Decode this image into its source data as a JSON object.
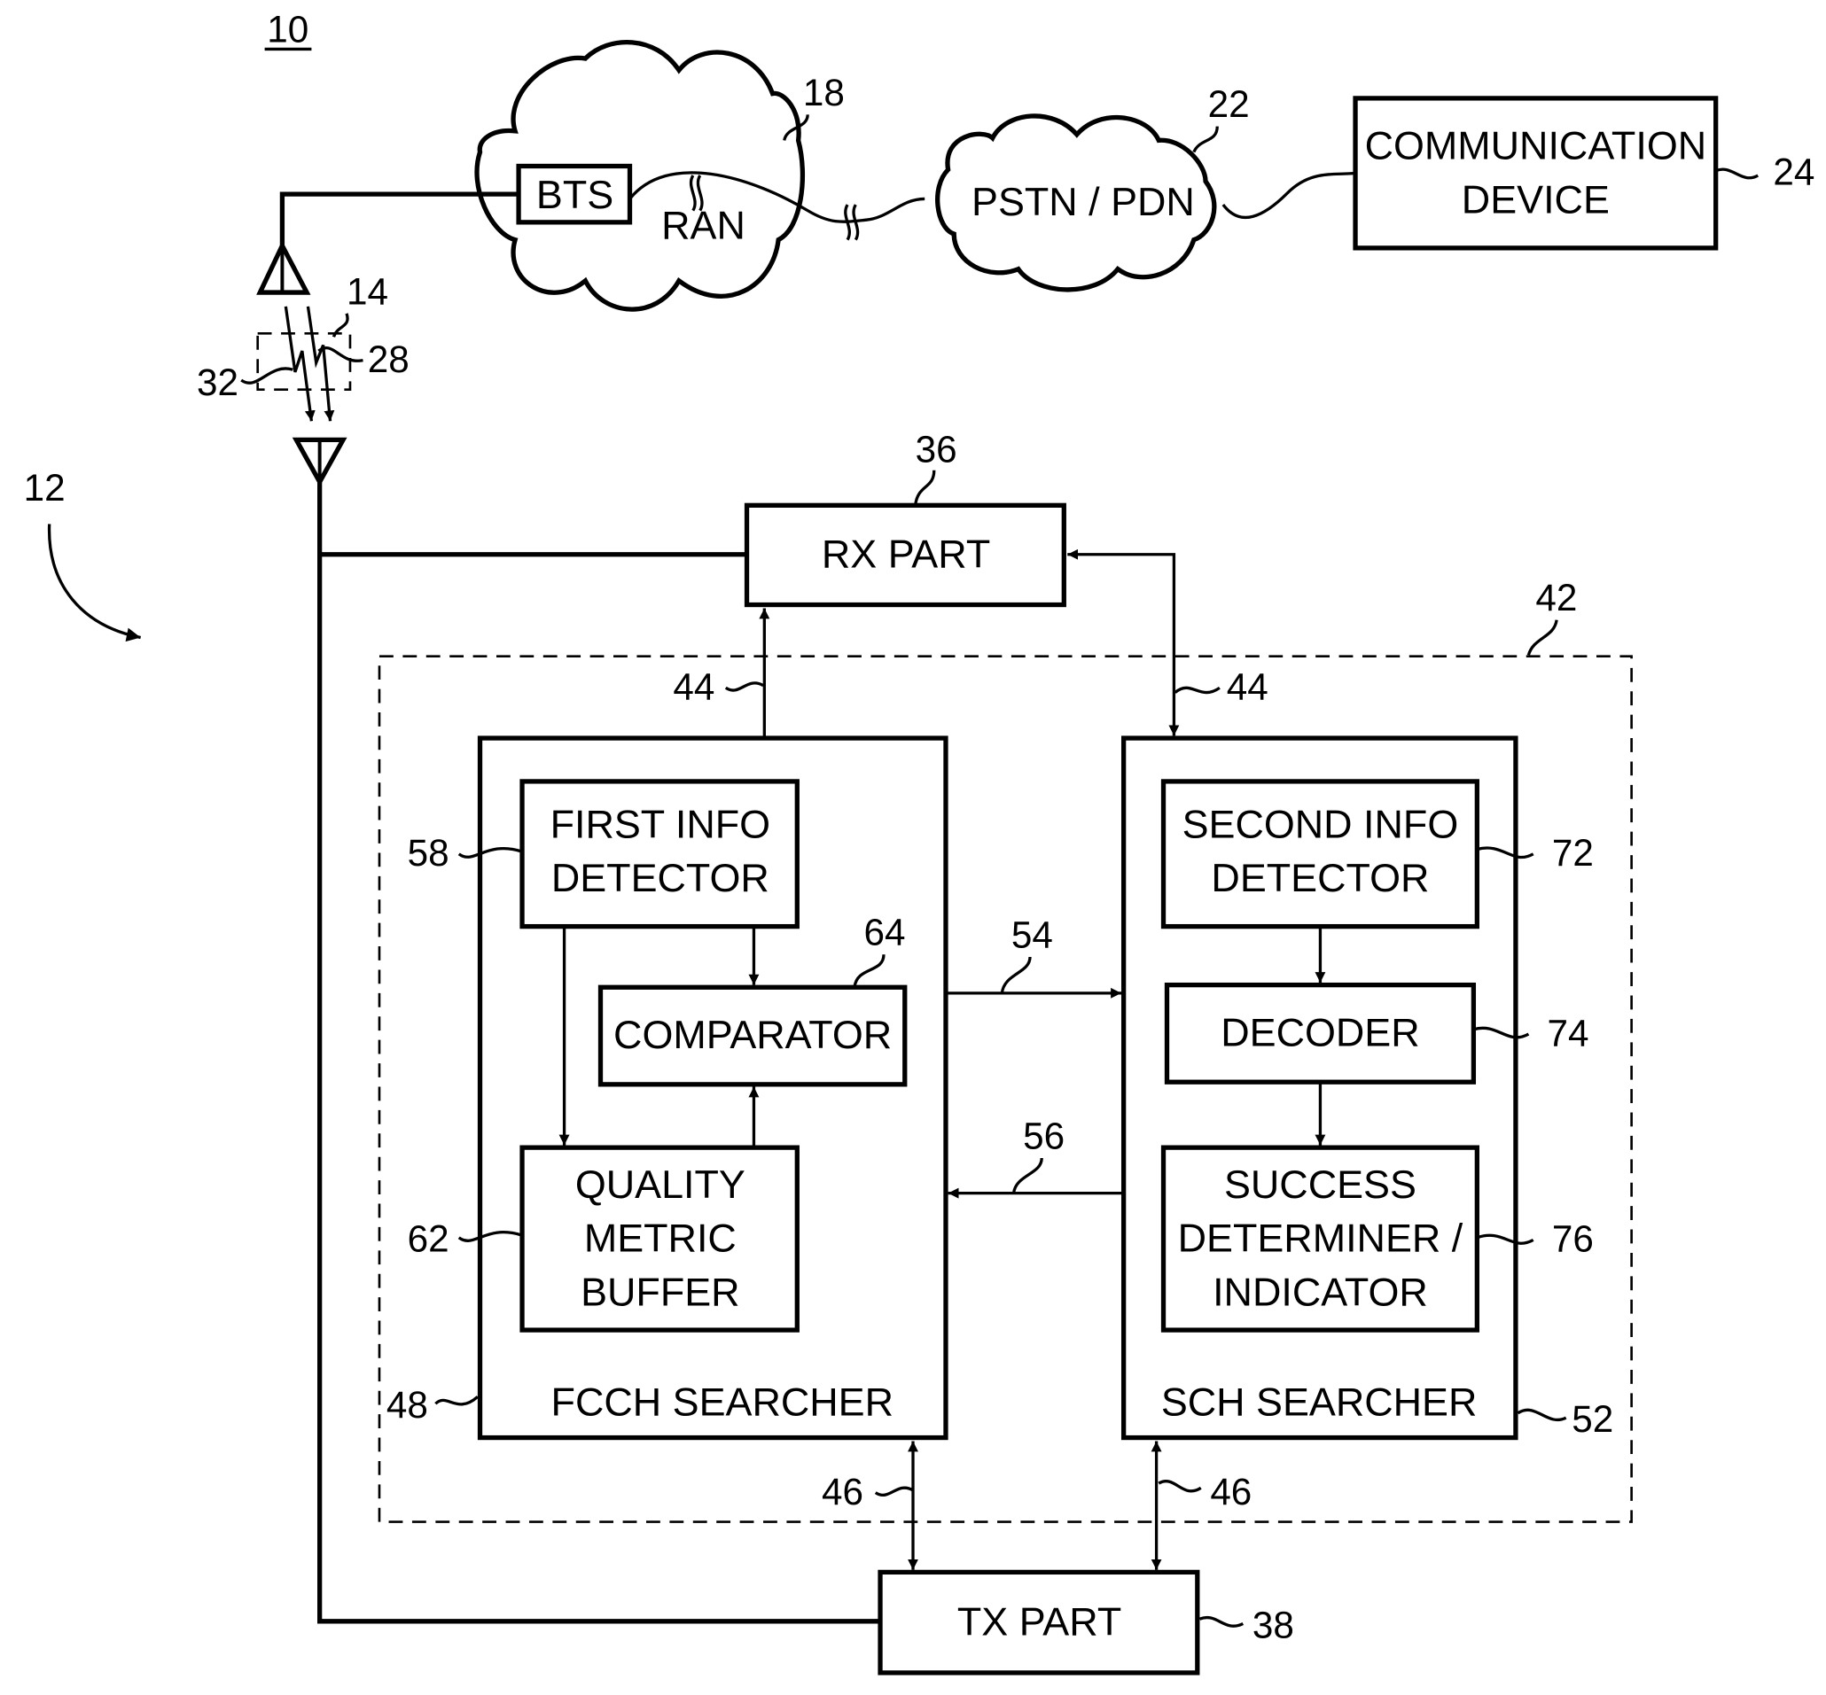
{
  "figure": {
    "number": "10",
    "references": {
      "system": "10",
      "mobile_station": "12",
      "channel": "14",
      "ran": "18",
      "pstn": "22",
      "comm_device": "24",
      "signal_a": "28",
      "signal_b": "32",
      "rx_part": "36",
      "tx_part": "38",
      "apparatus": "42",
      "rx_lines": "44",
      "tx_lines": "46",
      "fcch": "48",
      "sch": "52",
      "line_54": "54",
      "line_56": "56",
      "first_detector": "58",
      "buffer": "62",
      "comparator": "64",
      "second_detector": "72",
      "decoder": "74",
      "success": "76"
    }
  },
  "network": {
    "bts": "BTS",
    "ran": "RAN",
    "pstn": "PSTN / PDN",
    "comm_device": [
      "COMMUNICATION",
      "DEVICE"
    ]
  },
  "blocks": {
    "rx_part": "RX PART",
    "tx_part": "TX PART",
    "fcch_searcher": "FCCH SEARCHER",
    "sch_searcher": "SCH SEARCHER",
    "first_info_detector": [
      "FIRST INFO",
      "DETECTOR"
    ],
    "comparator": "COMPARATOR",
    "quality_metric_buffer": [
      "QUALITY",
      "METRIC",
      "BUFFER"
    ],
    "second_info_detector": [
      "SECOND INFO",
      "DETECTOR"
    ],
    "decoder": "DECODER",
    "success_determiner": [
      "SUCCESS",
      "DETERMINER /",
      "INDICATOR"
    ]
  }
}
